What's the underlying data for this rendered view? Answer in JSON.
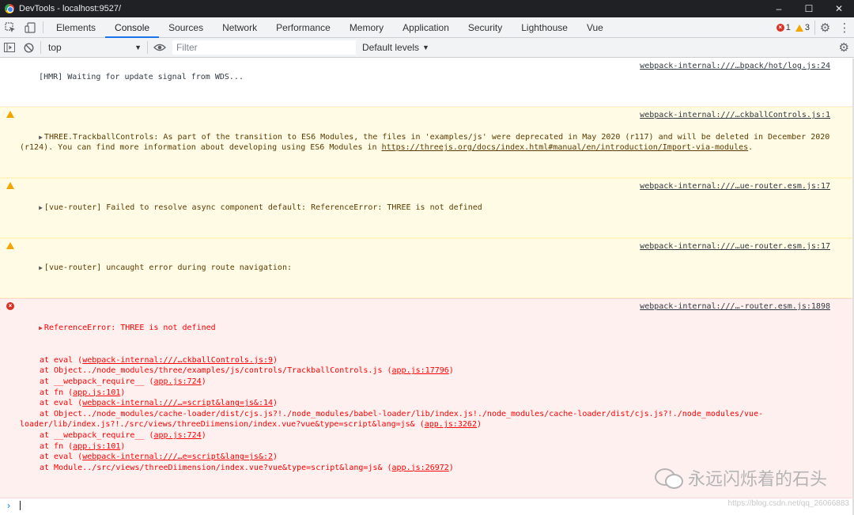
{
  "window": {
    "title": "DevTools - localhost:9527/",
    "controls": [
      "–",
      "☐",
      "✕"
    ]
  },
  "tabs": [
    "Elements",
    "Console",
    "Sources",
    "Network",
    "Performance",
    "Memory",
    "Application",
    "Security",
    "Lighthouse",
    "Vue"
  ],
  "active_tab": "Console",
  "counts": {
    "errors": "1",
    "warnings": "3"
  },
  "toolbar": {
    "context": "top",
    "filter_placeholder": "Filter",
    "levels": "Default levels"
  },
  "messages": [
    {
      "level": "log",
      "text": "[HMR] Waiting for update signal from WDS...",
      "source": "webpack-internal:///…bpack/hot/log.js:24"
    },
    {
      "level": "warn",
      "text": "THREE.TrackballControls: As part of the transition to ES6 Modules, the files in 'examples/js' were deprecated in May 2020 (r117) and will be deleted in December 2020 (r124). You can find more information about developing using ES6 Modules in ",
      "link": "https://threejs.org/docs/index.html#manual/en/introduction/Import-via-modules",
      "tail": ".",
      "source": "webpack-internal:///…ckballControls.js:1"
    },
    {
      "level": "warn",
      "text": "[vue-router] Failed to resolve async component default: ReferenceError: THREE is not defined",
      "source": "webpack-internal:///…ue-router.esm.js:17"
    },
    {
      "level": "warn",
      "text": "[vue-router] uncaught error during route navigation:",
      "source": "webpack-internal:///…ue-router.esm.js:17"
    },
    {
      "level": "error",
      "text": "ReferenceError: THREE is not defined",
      "source": "webpack-internal:///…-router.esm.js:1898"
    }
  ],
  "stack": [
    {
      "prefix": "at eval (",
      "link": "webpack-internal:///…ckballControls.js:9",
      "suffix": ")"
    },
    {
      "prefix": "at Object../node_modules/three/examples/js/controls/TrackballControls.js (",
      "link": "app.js:17796",
      "suffix": ")"
    },
    {
      "prefix": "at __webpack_require__ (",
      "link": "app.js:724",
      "suffix": ")"
    },
    {
      "prefix": "at fn (",
      "link": "app.js:101",
      "suffix": ")"
    },
    {
      "prefix": "at eval (",
      "link": "webpack-internal:///…=script&lang=js&:14",
      "suffix": ")"
    },
    {
      "prefix": "at Object../node_modules/cache-loader/dist/cjs.js?!./node_modules/babel-loader/lib/index.js!./node_modules/cache-loader/dist/cjs.js?!./node_modules/vue-",
      "link": "",
      "suffix": ""
    },
    {
      "prefix": "loader/lib/index.js?!./src/views/threeDiimension/index.vue?vue&type=script&lang=js& (",
      "link": "app.js:3262",
      "suffix": ")",
      "wrap": true
    },
    {
      "prefix": "at __webpack_require__ (",
      "link": "app.js:724",
      "suffix": ")"
    },
    {
      "prefix": "at fn (",
      "link": "app.js:101",
      "suffix": ")"
    },
    {
      "prefix": "at eval (",
      "link": "webpack-internal:///…e=script&lang=js&:2",
      "suffix": ")"
    },
    {
      "prefix": "at Module../src/views/threeDiimension/index.vue?vue&type=script&lang=js& (",
      "link": "app.js:26972",
      "suffix": ")"
    }
  ],
  "watermark": {
    "text": "永远闪烁着的石头",
    "url": "https://blog.csdn.net/qq_26066883"
  },
  "colors": {
    "accent": "#1a73e8",
    "error": "#ff0000",
    "warning_bg": "#fffbe5",
    "error_bg": "#fff0f0"
  }
}
